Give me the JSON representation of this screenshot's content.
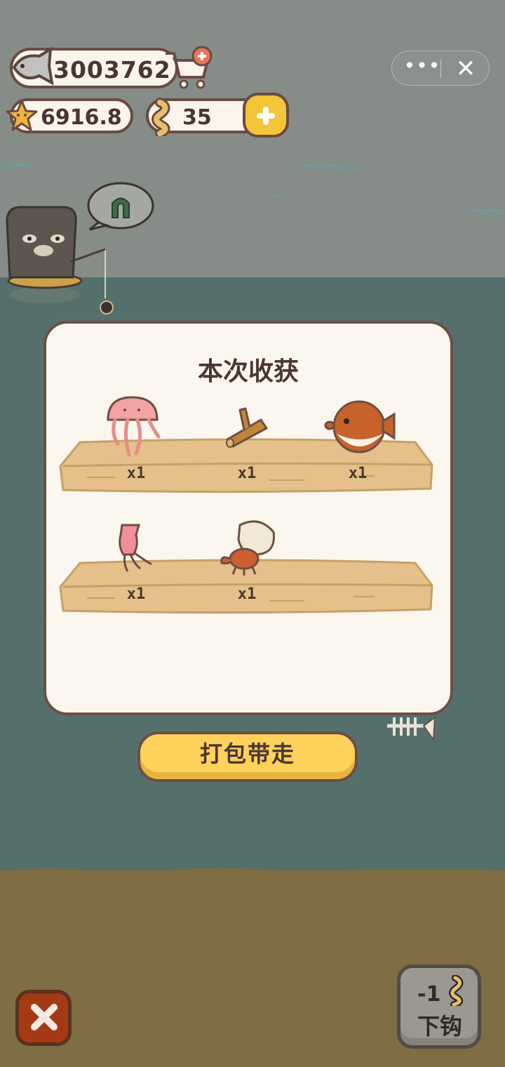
{
  "resources": {
    "fish_coins": "3003762",
    "stars": "6916.8",
    "bait": "35"
  },
  "top_capsule": {
    "more_label": "•••",
    "close_label": "✕"
  },
  "catch_panel": {
    "title": "本次收获",
    "rows": [
      {
        "items": [
          {
            "name": "jellyfish",
            "qty": "x1"
          },
          {
            "name": "driftwood",
            "qty": "x1"
          },
          {
            "name": "pufferfish",
            "qty": "x1"
          }
        ]
      },
      {
        "items": [
          {
            "name": "squid",
            "qty": "x1"
          },
          {
            "name": "hermit-crab",
            "qty": "x1"
          }
        ]
      }
    ]
  },
  "buttons": {
    "take_all": "打包带走",
    "hook_cost": "-1",
    "hook_label": "下钩"
  },
  "thought_bubble_item": "horseshoe-magnet",
  "colors": {
    "sky": "#868c88",
    "sea": "#55706c",
    "sand": "#7f6e43",
    "panel": "#fbf6ee",
    "accent_yellow": "#fdd15a",
    "border_brown": "#6e4e45"
  }
}
